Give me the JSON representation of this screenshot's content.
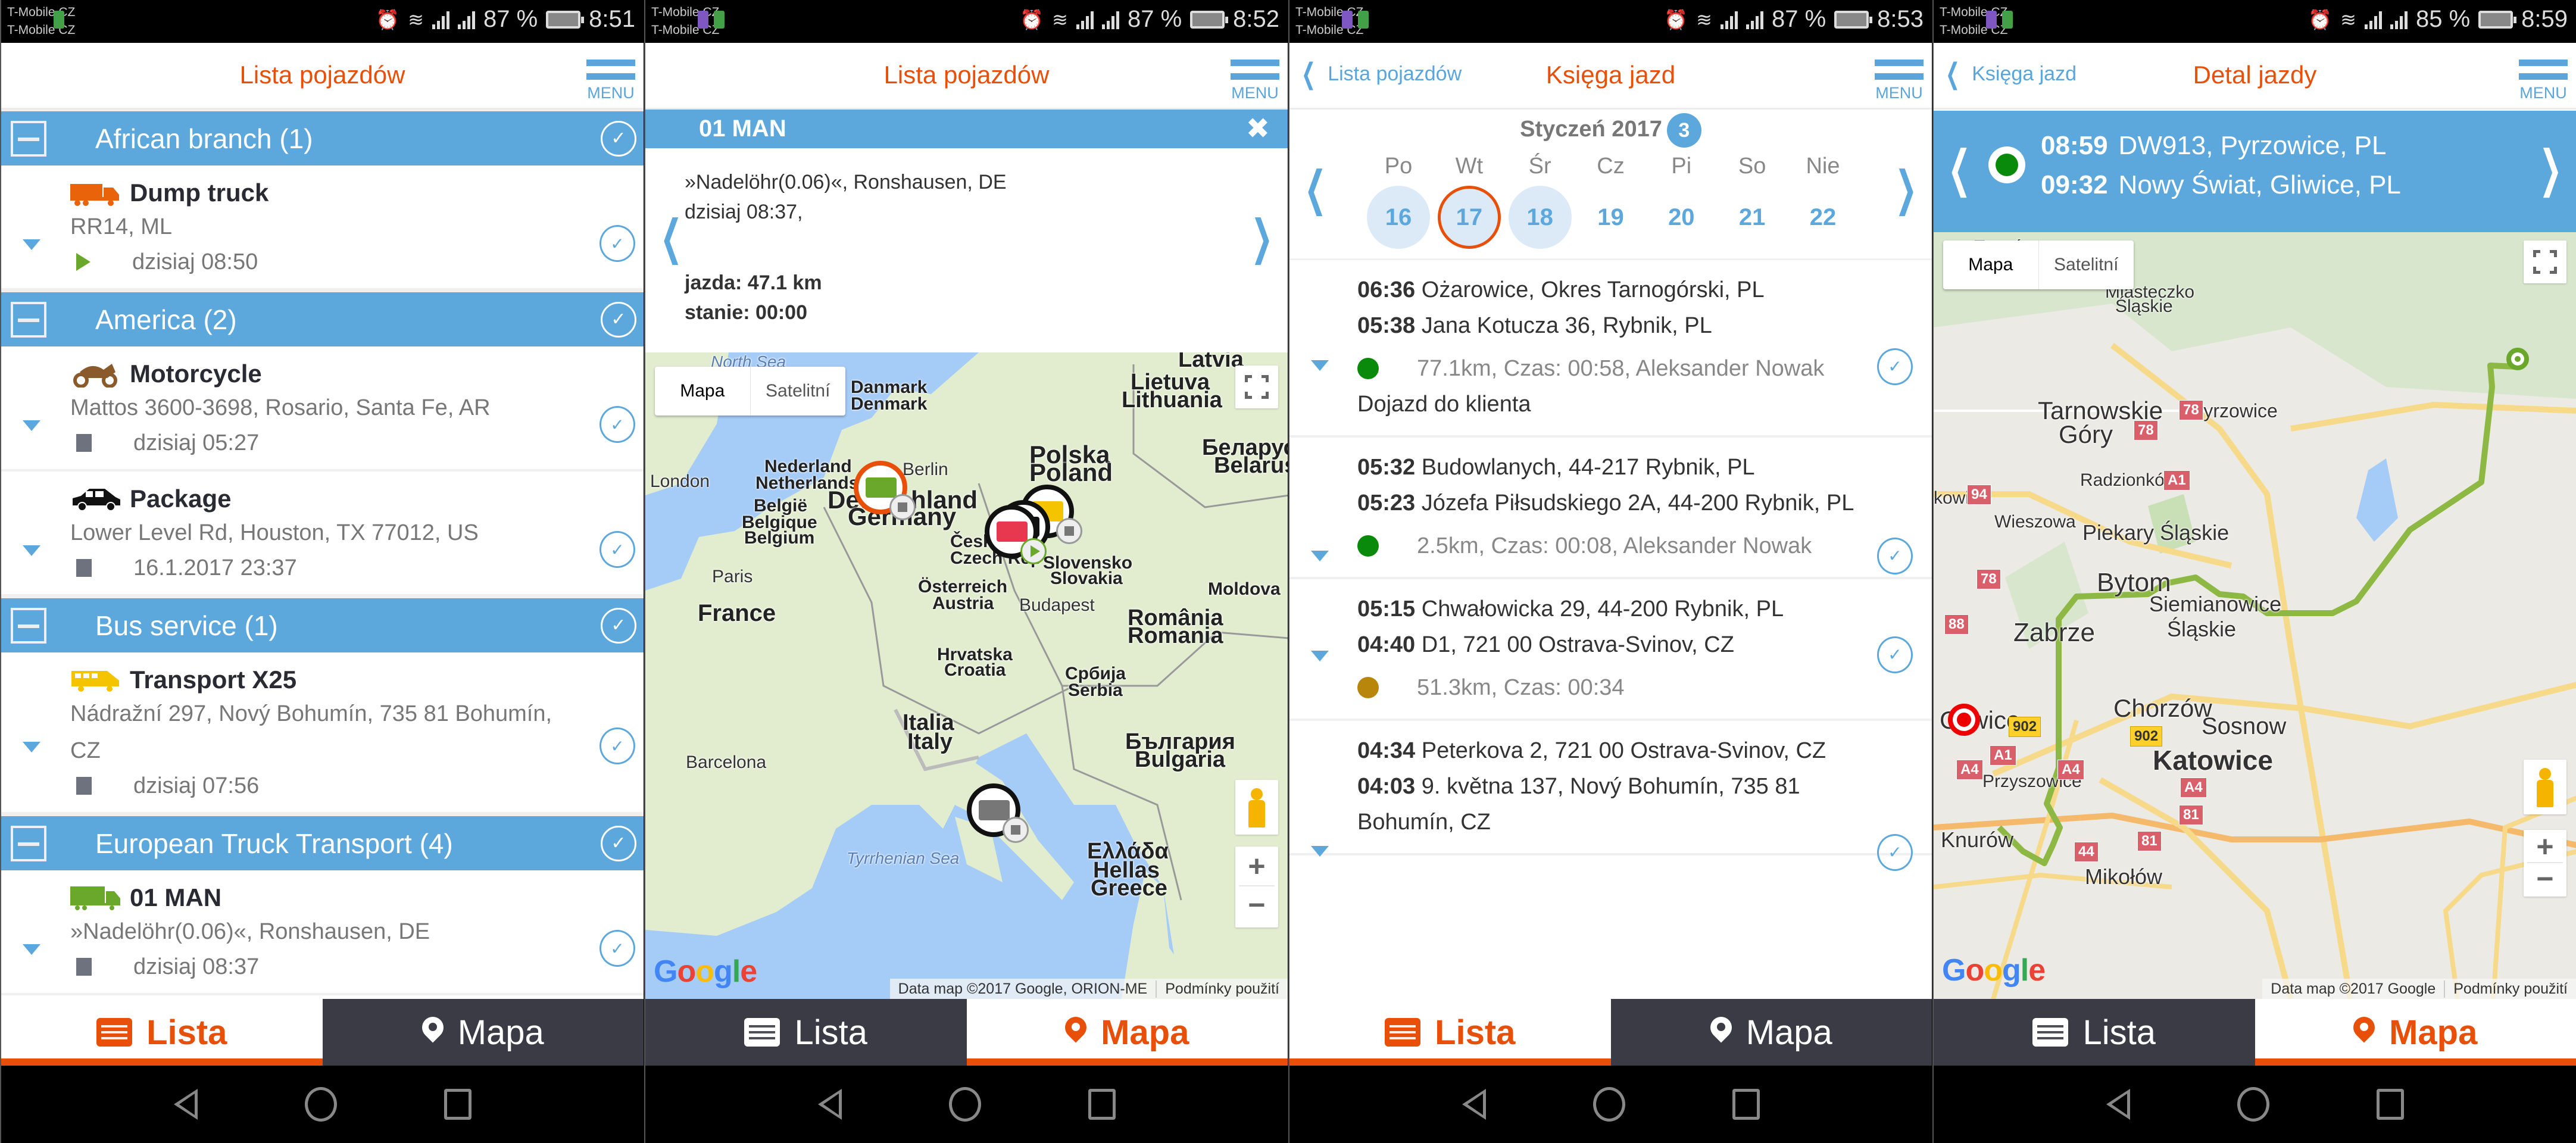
{
  "status_bars": [
    {
      "carrier1": "T-Mobile CZ",
      "carrier2": "T-Mobile CZ",
      "battery": "87 %",
      "time": "8:51"
    },
    {
      "carrier1": "T-Mobile CZ",
      "carrier2": "T-Mobile CZ",
      "battery": "87 %",
      "time": "8:52"
    },
    {
      "carrier1": "T-Mobile CZ",
      "carrier2": "T-Mobile CZ",
      "battery": "87 %",
      "time": "8:53"
    },
    {
      "carrier1": "T-Mobile CZ",
      "carrier2": "T-Mobile CZ",
      "battery": "85 %",
      "time": "8:59"
    }
  ],
  "menu_label": "MENU",
  "tabs": {
    "list": "Lista",
    "map": "Mapa"
  },
  "map_controls": {
    "map": "Mapa",
    "satellite": "Satelitní",
    "zoom_in": "+",
    "zoom_out": "−",
    "terms": "Podmínky použití"
  },
  "panel1": {
    "title": "Lista pojazdów",
    "groups": [
      {
        "name": "African branch (1)",
        "vehicles": [
          {
            "name": "Dump truck",
            "icon": "dump-truck-icon",
            "icon_color": "#e8630a",
            "address": "RR14, ML",
            "status": "play",
            "time": "dzisiaj 08:50"
          }
        ]
      },
      {
        "name": "America (2)",
        "vehicles": [
          {
            "name": "Motorcycle",
            "icon": "motorcycle-icon",
            "icon_color": "#8b5a2b",
            "address": "Mattos 3600-3698, Rosario, Santa Fe, AR",
            "status": "stop",
            "time": "dzisiaj 05:27"
          },
          {
            "name": "Package",
            "icon": "car-icon",
            "icon_color": "#111111",
            "address": "Lower Level Rd, Houston, TX 77012, US",
            "status": "stop",
            "time": "16.1.2017 23:37"
          }
        ]
      },
      {
        "name": "Bus service (1)",
        "vehicles": [
          {
            "name": "Transport X25",
            "icon": "van-icon",
            "icon_color": "#f5c400",
            "address": "Nádražní 297, Nový Bohumín, 735 81 Bohumín, CZ",
            "status": "stop",
            "time": "dzisiaj 07:56"
          }
        ]
      },
      {
        "name": "European Truck Transport (4)",
        "vehicles": [
          {
            "name": "01 MAN",
            "icon": "truck-icon",
            "icon_color": "#6aa82c",
            "address": "»Nadelöhr(0.06)«, Ronshausen, DE",
            "status": "stop",
            "time": "dzisiaj 08:37"
          }
        ]
      }
    ]
  },
  "panel2": {
    "title": "Lista pojazdów",
    "selected_vehicle": "01 MAN",
    "info": {
      "address": "»Nadelöhr(0.06)«, Ronshausen, DE",
      "time": "dzisiaj 08:37,",
      "driving": "jazda: 47.1 km",
      "standing": "stanie: 00:00"
    },
    "map_labels": {
      "north_sea": "North Sea",
      "denmark1": "Danmark",
      "denmark2": "Denmark",
      "latvia": "Latvia",
      "lithuania1": "Lietuva",
      "lithuania2": "Lithuania",
      "london": "London",
      "netherlands1": "Nederland",
      "netherlands2": "Netherlands",
      "berlin": "Berlin",
      "germany1": "Deutschland",
      "germany2": "Germany",
      "poland1": "Polska",
      "poland2": "Poland",
      "belarus1": "Беларусь",
      "belarus2": "Belarus",
      "belgium1": "België",
      "belgium2": "Belgique",
      "belgium3": "Belgium",
      "czech1": "Česká",
      "czech2": "Czech Rep",
      "slovakia1": "Slovensko",
      "slovakia2": "Slovakia",
      "paris": "Paris",
      "austria1": "Österreich",
      "austria2": "Austria",
      "budapest": "Budapest",
      "moldova": "Moldova",
      "france": "France",
      "romania1": "România",
      "romania2": "Romania",
      "croatia1": "Hrvatska",
      "croatia2": "Croatia",
      "serbia1": "Србија",
      "serbia2": "Serbia",
      "barcelona": "Barcelona",
      "italy1": "Italia",
      "italy2": "Italy",
      "bulgaria1": "България",
      "bulgaria2": "Bulgaria",
      "tyrrhenian": "Tyrrhenian Sea",
      "greece1": "Ελλάδα",
      "greece2": "Hellas",
      "greece3": "Greece"
    },
    "attribution": "Data map ©2017 Google, ORION-ME"
  },
  "panel3": {
    "back_label": "Lista pojazdów",
    "title": "Księga jazd",
    "month": "Styczeń 2017",
    "week_badge": "3",
    "weekdays": [
      "Po",
      "Wt",
      "Śr",
      "Cz",
      "Pi",
      "So",
      "Nie"
    ],
    "days": [
      {
        "day": "16",
        "has_data": true,
        "selected": false
      },
      {
        "day": "17",
        "has_data": true,
        "selected": true
      },
      {
        "day": "18",
        "has_data": true,
        "selected": false
      },
      {
        "day": "19",
        "has_data": false,
        "selected": false
      },
      {
        "day": "20",
        "has_data": false,
        "selected": false
      },
      {
        "day": "21",
        "has_data": false,
        "selected": false
      },
      {
        "day": "22",
        "has_data": false,
        "selected": false
      }
    ],
    "trips": [
      {
        "end_time": "06:36",
        "end_place": "Ożarowice, Okres Tarnogórski, PL",
        "start_time": "05:38",
        "start_place": "Jana Kotucza 36, Rybnik, PL",
        "dot_color": "#0a8a0a",
        "stats": "77.1km, Czas: 00:58, Aleksander Nowak",
        "note": "Dojazd do klienta"
      },
      {
        "end_time": "05:32",
        "end_place": "Budowlanych, 44-217 Rybnik, PL",
        "start_time": "05:23",
        "start_place": "Józefa Piłsudskiego 2A, 44-200 Rybnik, PL",
        "dot_color": "#0a8a0a",
        "stats": "2.5km, Czas: 00:08, Aleksander Nowak",
        "note": ""
      },
      {
        "end_time": "05:15",
        "end_place": "Chwałowicka 29, 44-200 Rybnik, PL",
        "start_time": "04:40",
        "start_place": "D1, 721 00 Ostrava-Svinov, CZ",
        "dot_color": "#b8860b",
        "stats": "51.3km, Czas: 00:34",
        "note": ""
      },
      {
        "end_time": "04:34",
        "end_place": "Peterkova 2, 721 00 Ostrava-Svinov, CZ",
        "start_time": "04:03",
        "start_place": "9. května 137, Nový Bohumín, 735 81 Bohumín, CZ",
        "dot_color": "",
        "stats": "",
        "note": ""
      }
    ]
  },
  "panel4": {
    "back_label": "Księga jazd",
    "title": "Detal jazdy",
    "start_time": "08:59",
    "start_place": "DW913, Pyrzowice, PL",
    "end_time": "09:32",
    "end_place": "Nowy Świat, Gliwice, PL",
    "map_labels": {
      "tworog": "Tworóg",
      "miasteczko1": "Miasteczko",
      "miasteczko2": "Śląskie",
      "pyrzowice": "Pyrzowice",
      "tarnowskie1": "Tarnowskie",
      "tarnowskie2": "Góry",
      "radzionkow": "Radzionków",
      "kowice": "kowice",
      "wieszowa": "Wieszowa",
      "piekary": "Piekary Śląskie",
      "bytom": "Bytom",
      "siemianowice1": "Siemianowice",
      "siemianowice2": "Śląskie",
      "zabrze": "Zabrze",
      "gliwice": "Gliwice",
      "chorzow": "Chorzów",
      "sosnowiec": "Sosnow",
      "katowice": "Katowice",
      "przyszowice": "Przyszowice",
      "knurow": "Knurów",
      "mikolow": "Mikołów"
    },
    "road_signs": [
      "78",
      "78",
      "94",
      "A1",
      "78",
      "88",
      "902",
      "902",
      "A1",
      "A4",
      "A4",
      "A4",
      "81",
      "81",
      "44"
    ],
    "attribution": "Data map ©2017 Google"
  }
}
